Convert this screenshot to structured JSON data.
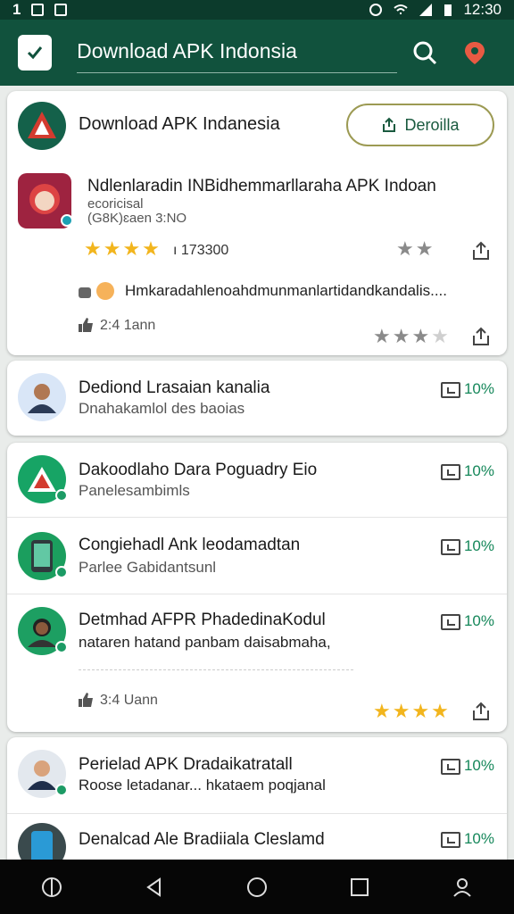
{
  "status_bar": {
    "left_text": "1",
    "time": "12:30"
  },
  "app_bar": {
    "title": "Download APK Indonsia"
  },
  "featured": {
    "header_title": "Download APK Indanesia",
    "open_button": "Deroilla",
    "app_title": "Ndlenlaradin INBidhemmarllaraha APK Indoan",
    "app_subtitle_1": "ecoricisal",
    "app_subtitle_2": "(G8K)ɛaen 3:NO",
    "rating_count": "173300",
    "review_text": "Hmkaradahlenoahdmunmanlartidandkandalis....",
    "likes_text": "2:4 1ann"
  },
  "list_a": [
    {
      "title": "Dediond Lrasaian kanalia",
      "subtitle": "Dnahakamlol des baoias",
      "percent": "10%"
    }
  ],
  "list_b": [
    {
      "title": "Dakoodlaho Dara Poguadry Eio",
      "subtitle": "Panelesambimls",
      "percent": "10%"
    },
    {
      "title": "Congiehadl Ank leodamadtan",
      "subtitle": "Parlee Gabidantsunl",
      "percent": "10%"
    },
    {
      "title": "Detmhad AFPR PhadedinaKodul",
      "subtitle": "nataren hatand panbam daisabmaha,",
      "percent": "10%"
    }
  ],
  "list_b_meta": "3:4 Uann",
  "list_c": [
    {
      "title": "Perielad APK Dradaikatratall",
      "subtitle": "Roose letadanar... hkataem poqjanal",
      "percent": "10%"
    },
    {
      "title": "Denalcad Ale Bradiiala Cleslamd",
      "subtitle": "",
      "percent": "10%"
    }
  ],
  "colors": {
    "app_bar": "#11523d",
    "accent_green": "#15875a",
    "star_gold": "#f2b51d"
  }
}
